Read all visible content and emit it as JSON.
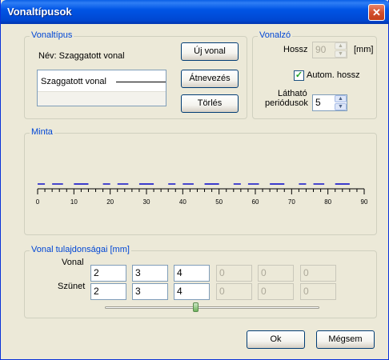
{
  "window": {
    "title": "Vonaltípusok",
    "close_symbol": "✕"
  },
  "vonaltipus": {
    "group_label": "Vonaltípus",
    "name_label": "Név: Szaggatott vonal",
    "preview_text": "Szaggatott vonal",
    "buttons": {
      "new": "Új vonal",
      "rename": "Átnevezés",
      "delete": "Törlés"
    }
  },
  "vonalzo": {
    "group_label": "Vonalzó",
    "length_label": "Hossz",
    "length_value": "90",
    "length_unit": "[mm]",
    "auto_length_label": "Autom. hossz",
    "auto_length_checked": true,
    "check_mark": "✓",
    "visible_periods_label_1": "Látható",
    "visible_periods_label_2": "periódusok",
    "visible_periods_value": "5"
  },
  "minta": {
    "group_label": "Minta"
  },
  "ruler": {
    "ticks": [
      "0",
      "10",
      "20",
      "30",
      "40",
      "50",
      "60",
      "70",
      "80",
      "90"
    ],
    "max_mm": 90,
    "pattern_mm": [
      2,
      2,
      3,
      3,
      4,
      4
    ],
    "dash_color": "#0000c8"
  },
  "properties": {
    "group_label": "Vonal tulajdonságai [mm]",
    "line_label": "Vonal",
    "gap_label": "Szünet",
    "line_values": [
      "2",
      "3",
      "4",
      "0",
      "0",
      "0"
    ],
    "gap_values": [
      "2",
      "3",
      "4",
      "0",
      "0",
      "0"
    ],
    "slider_value": 0.42
  },
  "footer": {
    "ok": "Ok",
    "cancel": "Mégsem"
  },
  "icons": {
    "spin_up": "▲",
    "spin_down": "▼"
  }
}
